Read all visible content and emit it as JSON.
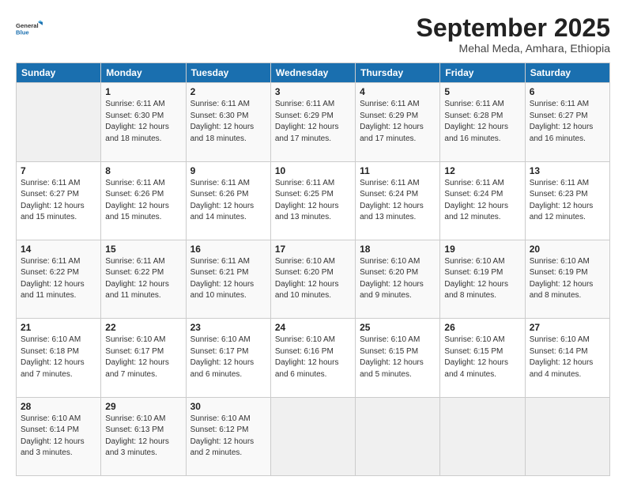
{
  "header": {
    "logo_general": "General",
    "logo_blue": "Blue",
    "month_title": "September 2025",
    "subtitle": "Mehal Meda, Amhara, Ethiopia"
  },
  "days_of_week": [
    "Sunday",
    "Monday",
    "Tuesday",
    "Wednesday",
    "Thursday",
    "Friday",
    "Saturday"
  ],
  "weeks": [
    [
      {
        "num": "",
        "info": ""
      },
      {
        "num": "1",
        "info": "Sunrise: 6:11 AM\nSunset: 6:30 PM\nDaylight: 12 hours\nand 18 minutes."
      },
      {
        "num": "2",
        "info": "Sunrise: 6:11 AM\nSunset: 6:30 PM\nDaylight: 12 hours\nand 18 minutes."
      },
      {
        "num": "3",
        "info": "Sunrise: 6:11 AM\nSunset: 6:29 PM\nDaylight: 12 hours\nand 17 minutes."
      },
      {
        "num": "4",
        "info": "Sunrise: 6:11 AM\nSunset: 6:29 PM\nDaylight: 12 hours\nand 17 minutes."
      },
      {
        "num": "5",
        "info": "Sunrise: 6:11 AM\nSunset: 6:28 PM\nDaylight: 12 hours\nand 16 minutes."
      },
      {
        "num": "6",
        "info": "Sunrise: 6:11 AM\nSunset: 6:27 PM\nDaylight: 12 hours\nand 16 minutes."
      }
    ],
    [
      {
        "num": "7",
        "info": "Sunrise: 6:11 AM\nSunset: 6:27 PM\nDaylight: 12 hours\nand 15 minutes."
      },
      {
        "num": "8",
        "info": "Sunrise: 6:11 AM\nSunset: 6:26 PM\nDaylight: 12 hours\nand 15 minutes."
      },
      {
        "num": "9",
        "info": "Sunrise: 6:11 AM\nSunset: 6:26 PM\nDaylight: 12 hours\nand 14 minutes."
      },
      {
        "num": "10",
        "info": "Sunrise: 6:11 AM\nSunset: 6:25 PM\nDaylight: 12 hours\nand 13 minutes."
      },
      {
        "num": "11",
        "info": "Sunrise: 6:11 AM\nSunset: 6:24 PM\nDaylight: 12 hours\nand 13 minutes."
      },
      {
        "num": "12",
        "info": "Sunrise: 6:11 AM\nSunset: 6:24 PM\nDaylight: 12 hours\nand 12 minutes."
      },
      {
        "num": "13",
        "info": "Sunrise: 6:11 AM\nSunset: 6:23 PM\nDaylight: 12 hours\nand 12 minutes."
      }
    ],
    [
      {
        "num": "14",
        "info": "Sunrise: 6:11 AM\nSunset: 6:22 PM\nDaylight: 12 hours\nand 11 minutes."
      },
      {
        "num": "15",
        "info": "Sunrise: 6:11 AM\nSunset: 6:22 PM\nDaylight: 12 hours\nand 11 minutes."
      },
      {
        "num": "16",
        "info": "Sunrise: 6:11 AM\nSunset: 6:21 PM\nDaylight: 12 hours\nand 10 minutes."
      },
      {
        "num": "17",
        "info": "Sunrise: 6:10 AM\nSunset: 6:20 PM\nDaylight: 12 hours\nand 10 minutes."
      },
      {
        "num": "18",
        "info": "Sunrise: 6:10 AM\nSunset: 6:20 PM\nDaylight: 12 hours\nand 9 minutes."
      },
      {
        "num": "19",
        "info": "Sunrise: 6:10 AM\nSunset: 6:19 PM\nDaylight: 12 hours\nand 8 minutes."
      },
      {
        "num": "20",
        "info": "Sunrise: 6:10 AM\nSunset: 6:19 PM\nDaylight: 12 hours\nand 8 minutes."
      }
    ],
    [
      {
        "num": "21",
        "info": "Sunrise: 6:10 AM\nSunset: 6:18 PM\nDaylight: 12 hours\nand 7 minutes."
      },
      {
        "num": "22",
        "info": "Sunrise: 6:10 AM\nSunset: 6:17 PM\nDaylight: 12 hours\nand 7 minutes."
      },
      {
        "num": "23",
        "info": "Sunrise: 6:10 AM\nSunset: 6:17 PM\nDaylight: 12 hours\nand 6 minutes."
      },
      {
        "num": "24",
        "info": "Sunrise: 6:10 AM\nSunset: 6:16 PM\nDaylight: 12 hours\nand 6 minutes."
      },
      {
        "num": "25",
        "info": "Sunrise: 6:10 AM\nSunset: 6:15 PM\nDaylight: 12 hours\nand 5 minutes."
      },
      {
        "num": "26",
        "info": "Sunrise: 6:10 AM\nSunset: 6:15 PM\nDaylight: 12 hours\nand 4 minutes."
      },
      {
        "num": "27",
        "info": "Sunrise: 6:10 AM\nSunset: 6:14 PM\nDaylight: 12 hours\nand 4 minutes."
      }
    ],
    [
      {
        "num": "28",
        "info": "Sunrise: 6:10 AM\nSunset: 6:14 PM\nDaylight: 12 hours\nand 3 minutes."
      },
      {
        "num": "29",
        "info": "Sunrise: 6:10 AM\nSunset: 6:13 PM\nDaylight: 12 hours\nand 3 minutes."
      },
      {
        "num": "30",
        "info": "Sunrise: 6:10 AM\nSunset: 6:12 PM\nDaylight: 12 hours\nand 2 minutes."
      },
      {
        "num": "",
        "info": ""
      },
      {
        "num": "",
        "info": ""
      },
      {
        "num": "",
        "info": ""
      },
      {
        "num": "",
        "info": ""
      }
    ]
  ]
}
